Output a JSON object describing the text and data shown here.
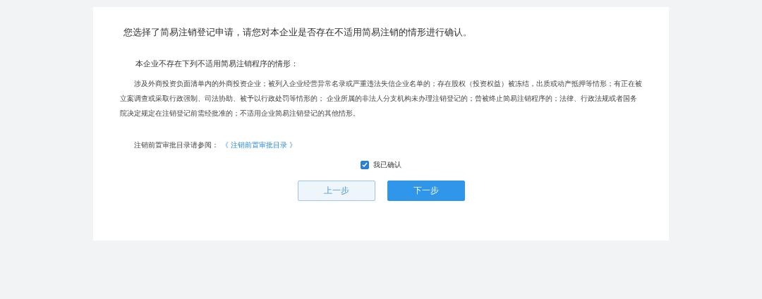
{
  "heading": "您选择了简易注销登记申请，请您对本企业是否存在不适用简易注销的情形进行确认。",
  "subheading": "本企业不存在下列不适用简易注销程序的情形：",
  "paragraph": "涉及外商投资负面清单内的外商投资企业；被列入企业经营异常名录或严重违法失信企业名单的；存在股权（投资权益）被冻结，出质或动产抵押等情形；有正在被立案调查或采取行政强制、司法协助、被予以行政处罚等情形的； 企业所属的非法人分支机构未办理注销登记的；曾被终止简易注销程序的；法律、行政法规或者国务院决定规定在注销登记前需经批准的；不适用企业简易注销登记的其他情形。",
  "reference": {
    "label": "注销前置审批目录请参阅：",
    "link": "《 注销前置审批目录 》"
  },
  "confirm": {
    "label": "我已确认",
    "checked": true
  },
  "buttons": [
    {
      "label": "上一步",
      "kind": "secondary"
    },
    {
      "label": "下一步",
      "kind": "primary"
    }
  ]
}
